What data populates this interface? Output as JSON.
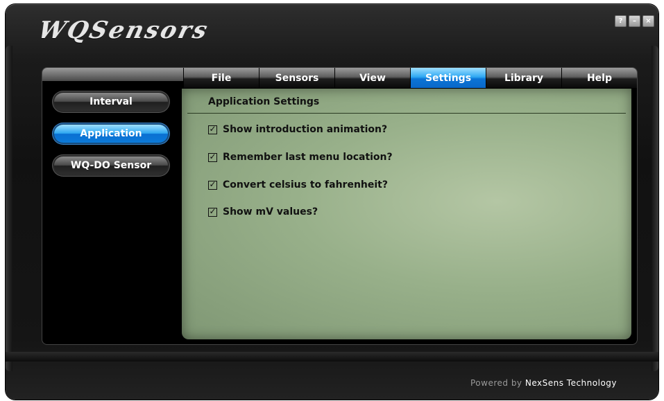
{
  "app": {
    "logo_text": "WQSensors",
    "window_controls": [
      {
        "icon": "help-icon",
        "glyph": "?"
      },
      {
        "icon": "minimize-icon",
        "glyph": "–"
      },
      {
        "icon": "close-icon",
        "glyph": "×"
      }
    ]
  },
  "menu": {
    "items": [
      {
        "label": "File"
      },
      {
        "label": "Sensors"
      },
      {
        "label": "View"
      },
      {
        "label": "Settings",
        "active": true
      },
      {
        "label": "Library"
      },
      {
        "label": "Help"
      }
    ]
  },
  "nav": {
    "items": [
      {
        "label": "Interval"
      },
      {
        "label": "Application",
        "active": true
      },
      {
        "label": "WQ-DO Sensor"
      }
    ]
  },
  "content": {
    "title": "Application Settings",
    "options": [
      {
        "label": "Show introduction animation?",
        "checked": true
      },
      {
        "label": "Remember last menu location?",
        "checked": true
      },
      {
        "label": "Convert celsius to fahrenheit?",
        "checked": true
      },
      {
        "label": "Show mV values?",
        "checked": true
      }
    ]
  },
  "footer": {
    "powered_prefix": "Powered by ",
    "powered_brand": "NexSens Technology"
  },
  "colors": {
    "accent_blue": "#0b74d6",
    "content_green": "#98b08a",
    "frame_dark": "#111111"
  }
}
